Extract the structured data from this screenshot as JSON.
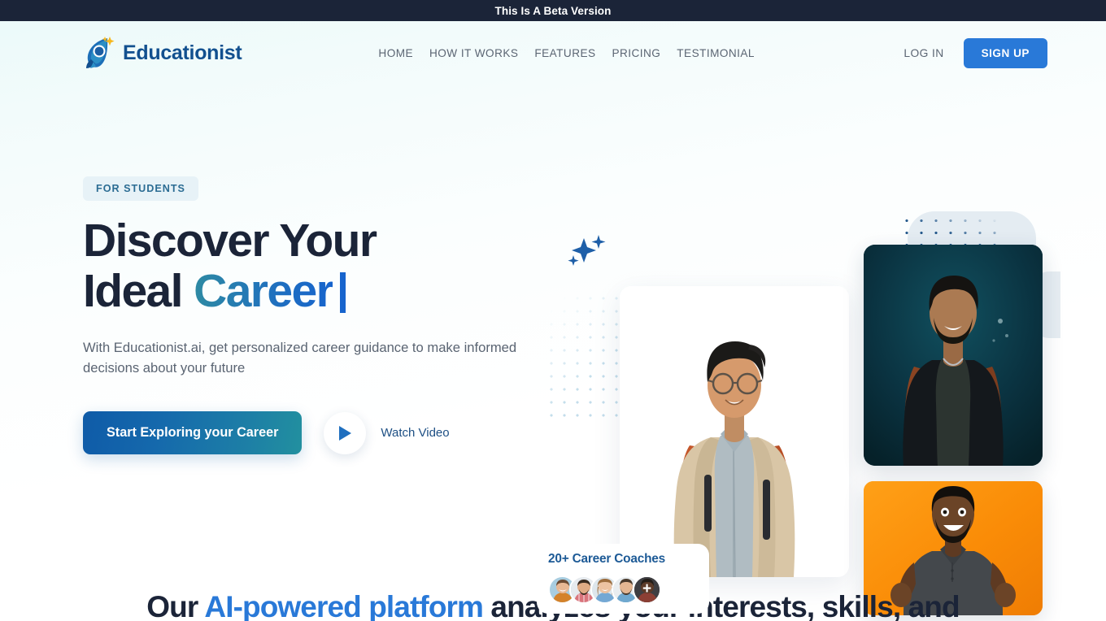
{
  "beta_banner": {
    "text": "This Is A Beta Version"
  },
  "header": {
    "brand_name": "Educationist",
    "brand_icon": "rocket-graduate-logo-icon",
    "nav": [
      {
        "label": "HOME"
      },
      {
        "label": "HOW IT WORKS"
      },
      {
        "label": "FEATURES"
      },
      {
        "label": "PRICING"
      },
      {
        "label": "TESTIMONIAL"
      }
    ],
    "login_label": "LOG IN",
    "signup_label": "SIGN UP",
    "signup_color": "#2979d8"
  },
  "hero": {
    "badge": "FOR STUDENTS",
    "headline_line1": "Discover Your",
    "headline_line2_plain": "Ideal ",
    "headline_line2_accent": "Career",
    "headline_accent_color": "#1764cd",
    "subtitle": "With Educationist.ai, get personalized career guidance to make informed decisions about your future",
    "cta_label": "Start Exploring your Career",
    "watch_label": "Watch Video",
    "play_icon": "play-triangle-icon",
    "sparkle_icon": "sparkle-stars-icon",
    "coaches_title": "20+ Career Coaches",
    "coaches_more_glyph": "+"
  },
  "bottom": {
    "head_part1": "Our ",
    "head_accent": "AI-powered platform",
    "head_part2": " analyzes your interests, skills, and",
    "accent_color": "#2979d8"
  }
}
